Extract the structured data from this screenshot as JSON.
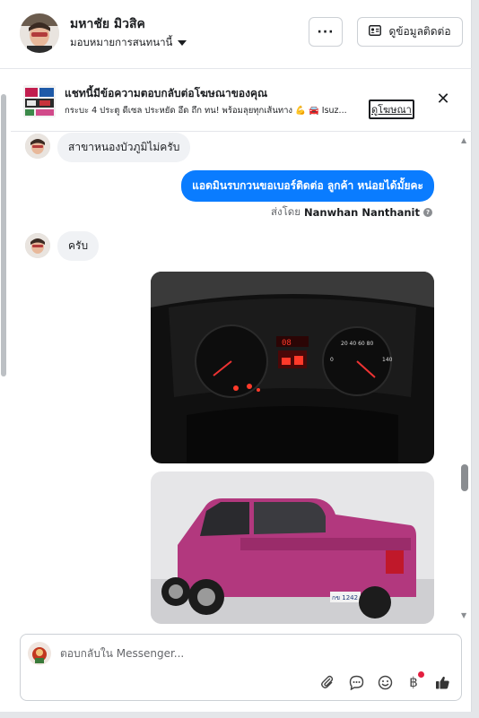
{
  "header": {
    "user_name": "มหาชัย มิวสิค",
    "assign_label": "มอบหมายการสนทนานี้",
    "more_label": "···",
    "contact_label": "ดูข้อมูลติดต่อ"
  },
  "ad_banner": {
    "title": "แชทนี้มีข้อความตอบกลับต่อโฆษณาของคุณ",
    "subtitle": "กระบะ 4 ประตู ดีเซล ประหยัด อึด ถึก ทน! พร้อมลุยทุกเส้นทาง 💪 🚘 Isuz...",
    "link_label": "ดูโฆษณา"
  },
  "messages": [
    {
      "direction": "in",
      "text": "สาขาหนองบัวภูมิไม่ครับ"
    },
    {
      "direction": "out",
      "text": "แอดมินรบกวนขอเบอร์ติดต่อ ลูกค้า หน่อยได้มั้ยคะ"
    },
    {
      "direction": "in",
      "text": "ครับ"
    }
  ],
  "sent_by": {
    "prefix": "ส่งโดย",
    "name": "Nanwhan Nanthanit"
  },
  "composer": {
    "placeholder": "ตอบกลับใน Messenger..."
  },
  "icons": {
    "attach": "paperclip-icon",
    "saved_replies": "chat-bubble-icon",
    "emoji": "smiley-icon",
    "payment": "baht-icon",
    "like": "thumbs-up-icon"
  },
  "colors": {
    "accent": "#0a7cff",
    "incoming_bubble": "#f0f2f5",
    "notification_dot": "#e41e3f",
    "car_body": "#b2387e"
  }
}
